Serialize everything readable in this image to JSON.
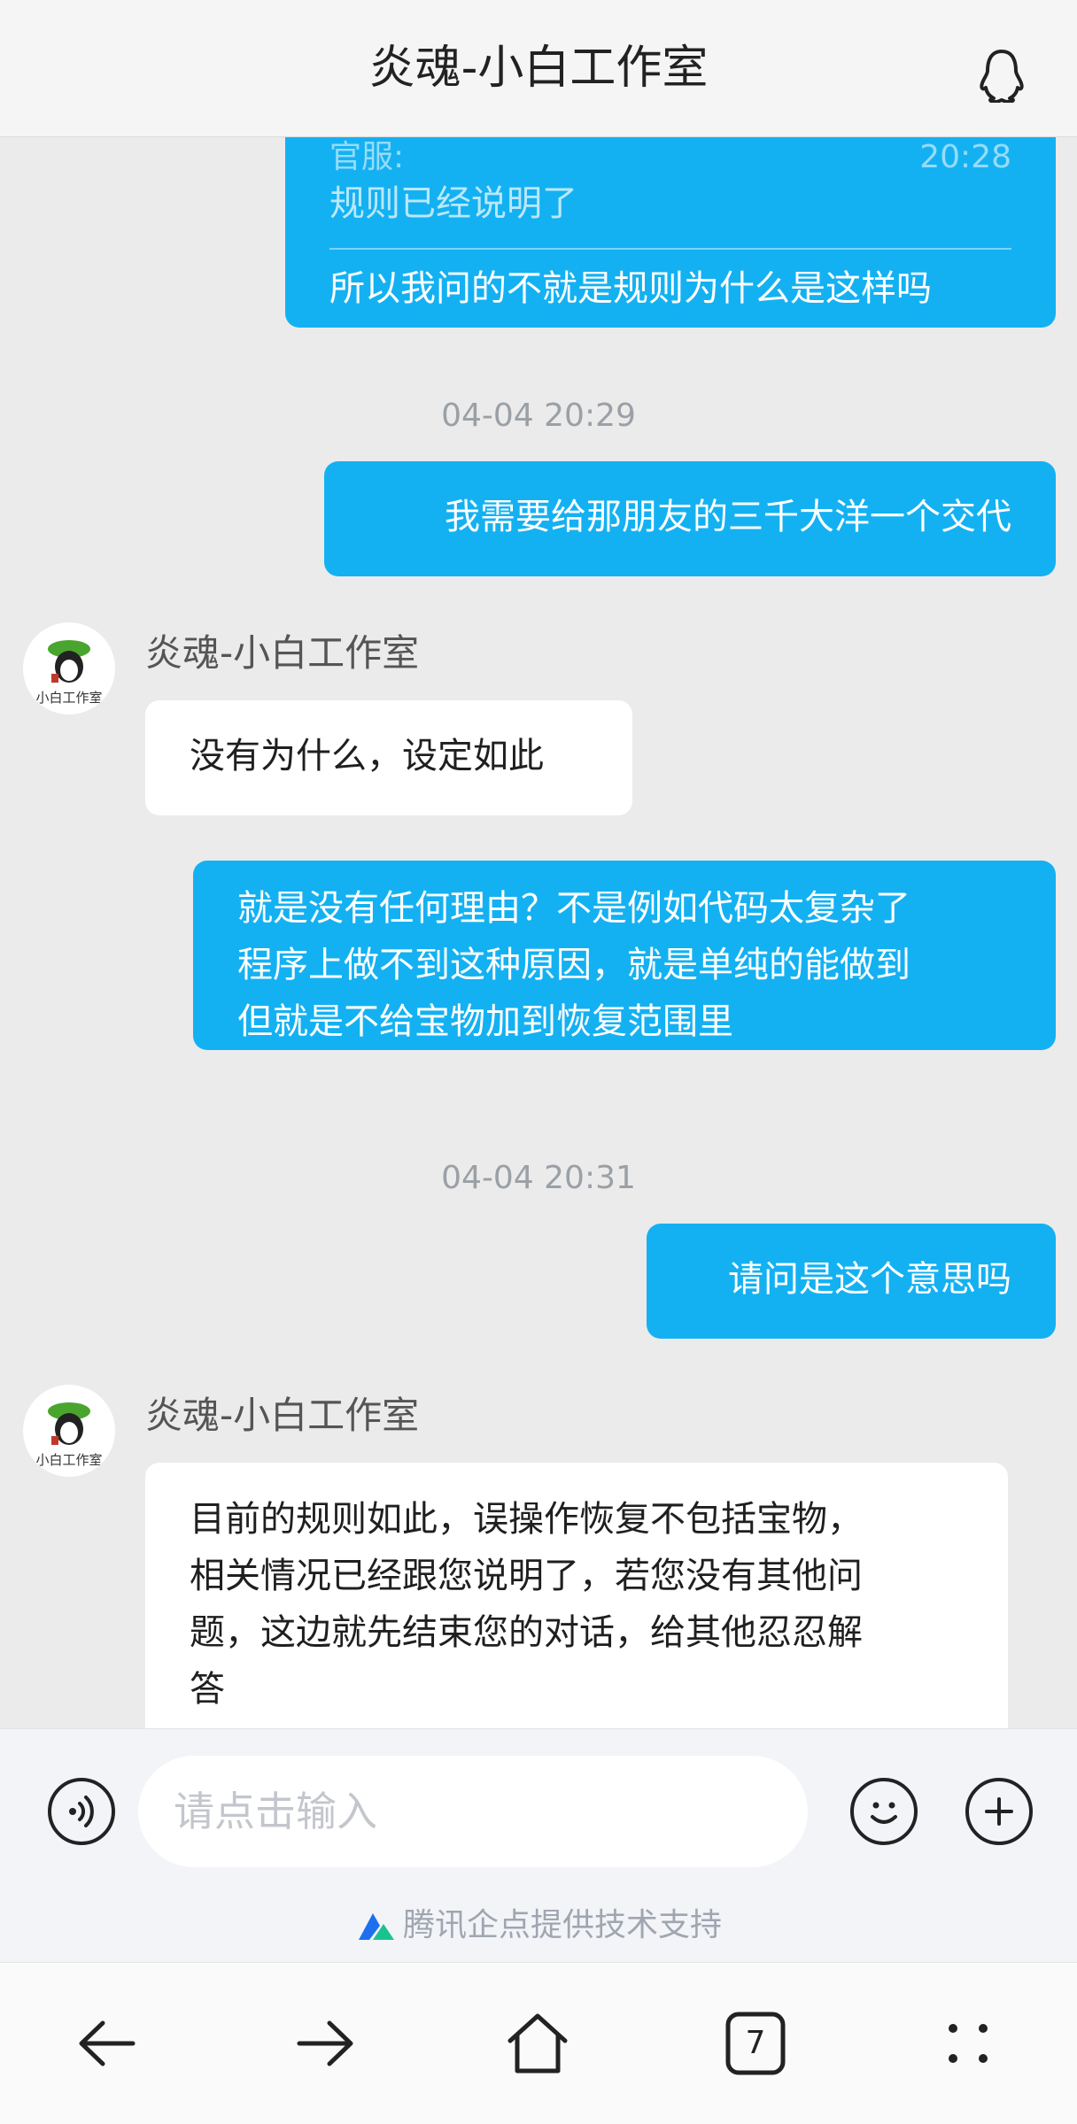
{
  "header": {
    "title": "炎魂-小白工作室",
    "icon": "qq-penguin-icon"
  },
  "messages": {
    "m1": {
      "quote_sender": "官服:",
      "quote_time": "20:28",
      "quote_text": "规则已经说明了",
      "text": "所以我问的不就是规则为什么是这样吗"
    },
    "ts1": "04-04 20:29",
    "m2": {
      "text": "我需要给那朋友的三千大洋一个交代"
    },
    "m3": {
      "sender": "炎魂-小白工作室",
      "avatar_text": "小白工作室",
      "text": "没有为什么，设定如此"
    },
    "m4": {
      "lines": [
        "就是没有任何理由？不是例如代码太复杂了",
        "程序上做不到这种原因，就是单纯的能做到",
        "但就是不给宝物加到恢复范围里"
      ]
    },
    "ts2": "04-04 20:31",
    "m5": {
      "text": "请问是这个意思吗"
    },
    "m6": {
      "sender": "炎魂-小白工作室",
      "avatar_text": "小白工作室",
      "lines": [
        "目前的规则如此，误操作恢复不包括宝物，",
        "相关情况已经跟您说明了，若您没有其他问",
        "题，这边就先结束您的对话，给其他忍忍解",
        "答"
      ]
    }
  },
  "input": {
    "placeholder": "请点击输入",
    "voice_icon": "voice-icon",
    "emoji_icon": "emoji-icon",
    "plus_icon": "plus-icon"
  },
  "powered_by": "腾讯企点提供技术支持",
  "navbar": {
    "tab_count": "7"
  },
  "colors": {
    "accent": "#14b1f2",
    "background": "#ebebeb"
  }
}
